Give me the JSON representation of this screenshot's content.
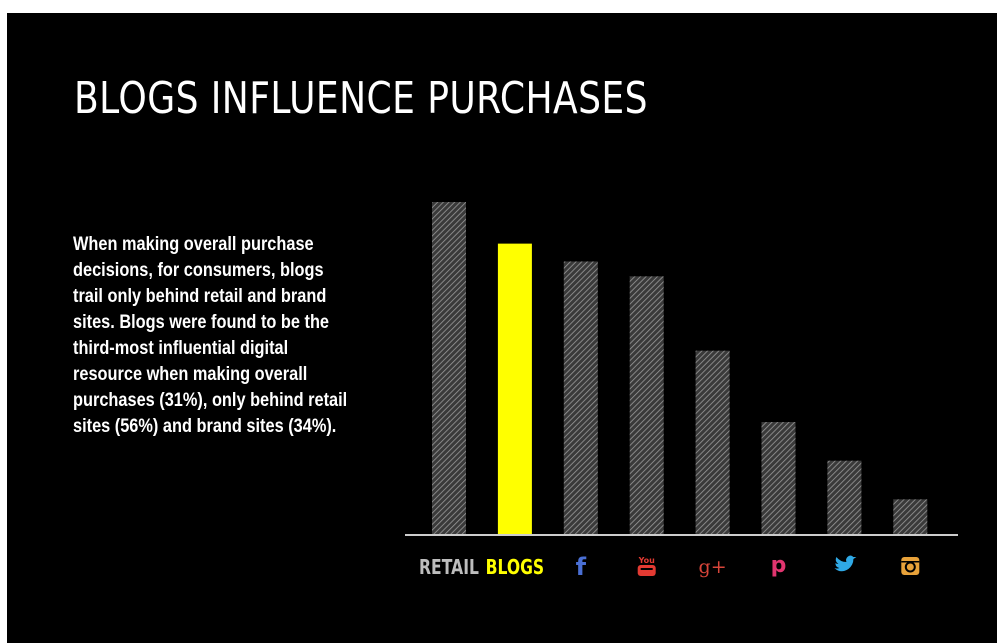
{
  "slide": {
    "title": "BLOGS INFLUENCE PURCHASES",
    "description": "When making overall purchase decisions, for consumers, blogs trail only behind retail and brand sites. Blogs were found to be the third-most influential digital resource when making overall purchases  (31%), only behind retail sites (56%) and brand sites (34%)."
  },
  "chart_data": {
    "type": "bar",
    "categories": [
      "RETAIL",
      "BLOGS",
      "facebook",
      "youtube",
      "google-plus",
      "pinterest",
      "twitter",
      "instagram"
    ],
    "category_labels": [
      "RETAIL",
      "BLOGS",
      "f",
      "You",
      "g+",
      "p",
      "",
      ""
    ],
    "category_icons": [
      "",
      "",
      "facebook-icon",
      "youtube-icon",
      "google-plus-icon",
      "pinterest-icon",
      "twitter-icon",
      "instagram-icon"
    ],
    "values": [
      56,
      49,
      46,
      43.5,
      31,
      19,
      12.5,
      6
    ],
    "highlight": "BLOGS",
    "colors": {
      "bar": "#3a3a3a",
      "bar_hatch": "#9a9a9a",
      "highlight": "#ffff00",
      "retail_label": "#bdbdbd",
      "blogs_label": "#ffff00",
      "facebook": "#4a6fd4",
      "youtube": "#e33a32",
      "google-plus": "#d8453a",
      "pinterest": "#e1356f",
      "twitter": "#2fa9e6",
      "instagram": "#e8a23a"
    },
    "ylim": [
      0,
      57
    ],
    "grid": false,
    "baseline": true
  }
}
